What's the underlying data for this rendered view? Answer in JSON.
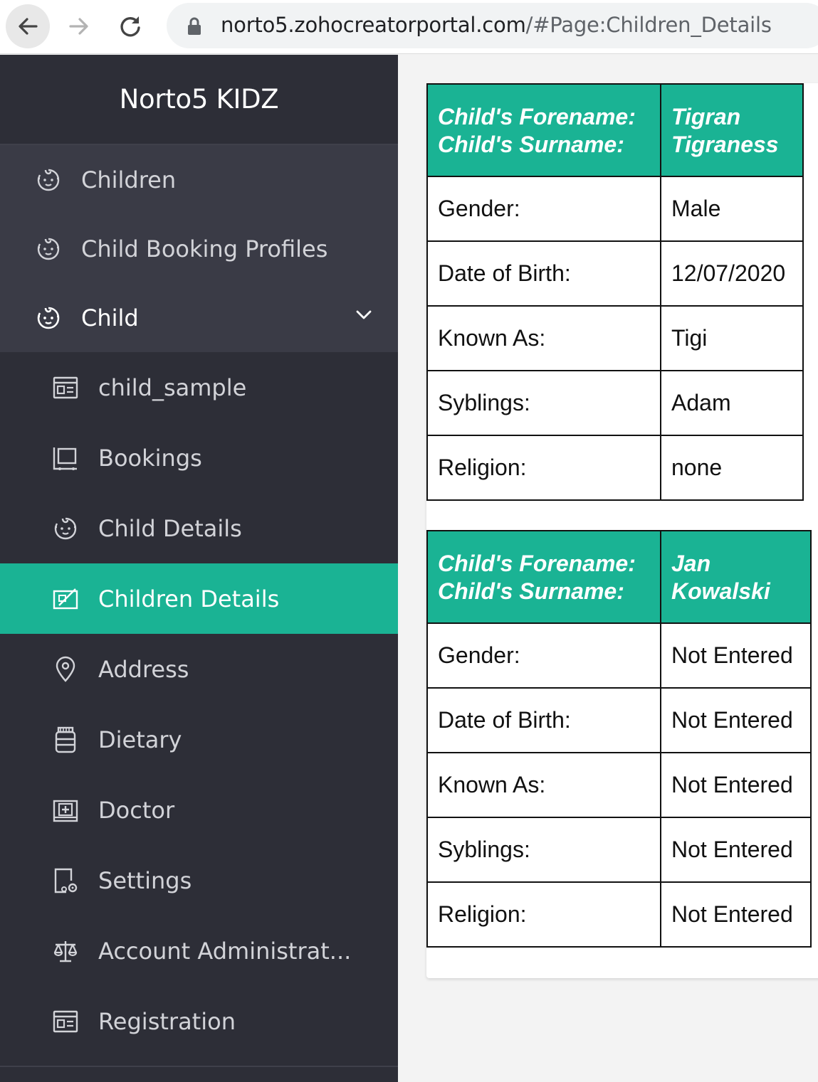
{
  "browser": {
    "url_host": "norto5.zohocreatorportal.com",
    "url_path": "/#Page:Children_Details"
  },
  "sidebar": {
    "brand": "Norto5 KIDZ",
    "top_items": [
      {
        "label": "Children",
        "icon": "baby-face-icon"
      },
      {
        "label": "Child Booking Profiles",
        "icon": "baby-face-icon"
      },
      {
        "label": "Child",
        "icon": "baby-face-icon"
      }
    ],
    "sub_items": [
      {
        "label": "child_sample",
        "icon": "form-icon"
      },
      {
        "label": "Bookings",
        "icon": "cart-icon"
      },
      {
        "label": "Child Details",
        "icon": "baby-face-icon"
      },
      {
        "label": "Children Details",
        "icon": "page-edit-icon"
      },
      {
        "label": "Address",
        "icon": "location-pin-icon"
      },
      {
        "label": "Dietary",
        "icon": "jar-icon"
      },
      {
        "label": "Doctor",
        "icon": "medical-kit-icon"
      },
      {
        "label": "Settings",
        "icon": "settings-doc-icon"
      },
      {
        "label": "Account Administrat...",
        "icon": "scales-icon"
      },
      {
        "label": "Registration",
        "icon": "form-icon"
      }
    ]
  },
  "children": [
    {
      "header_labels": [
        "Child's Forename:",
        "Child's Surname:"
      ],
      "forename": "Tigran",
      "surname": "Tigraness",
      "rows": [
        {
          "label": "Gender:",
          "value": "Male"
        },
        {
          "label": "Date of Birth:",
          "value": "12/07/2020"
        },
        {
          "label": "Known As:",
          "value": "Tigi"
        },
        {
          "label": "Syblings:",
          "value": "Adam"
        },
        {
          "label": "Religion:",
          "value": "none"
        }
      ]
    },
    {
      "header_labels": [
        "Child's Forename:",
        "Child's Surname:"
      ],
      "forename": "Jan",
      "surname": "Kowalski",
      "rows": [
        {
          "label": "Gender:",
          "value": "Not Entered"
        },
        {
          "label": "Date of Birth:",
          "value": "Not Entered"
        },
        {
          "label": "Known As:",
          "value": "Not Entered"
        },
        {
          "label": "Syblings:",
          "value": "Not Entered"
        },
        {
          "label": "Religion:",
          "value": "Not Entered"
        }
      ]
    }
  ],
  "colors": {
    "accent": "#1ab394",
    "sidebar_bg": "#2d2e37",
    "sidebar_top_bg": "#3a3b46"
  }
}
